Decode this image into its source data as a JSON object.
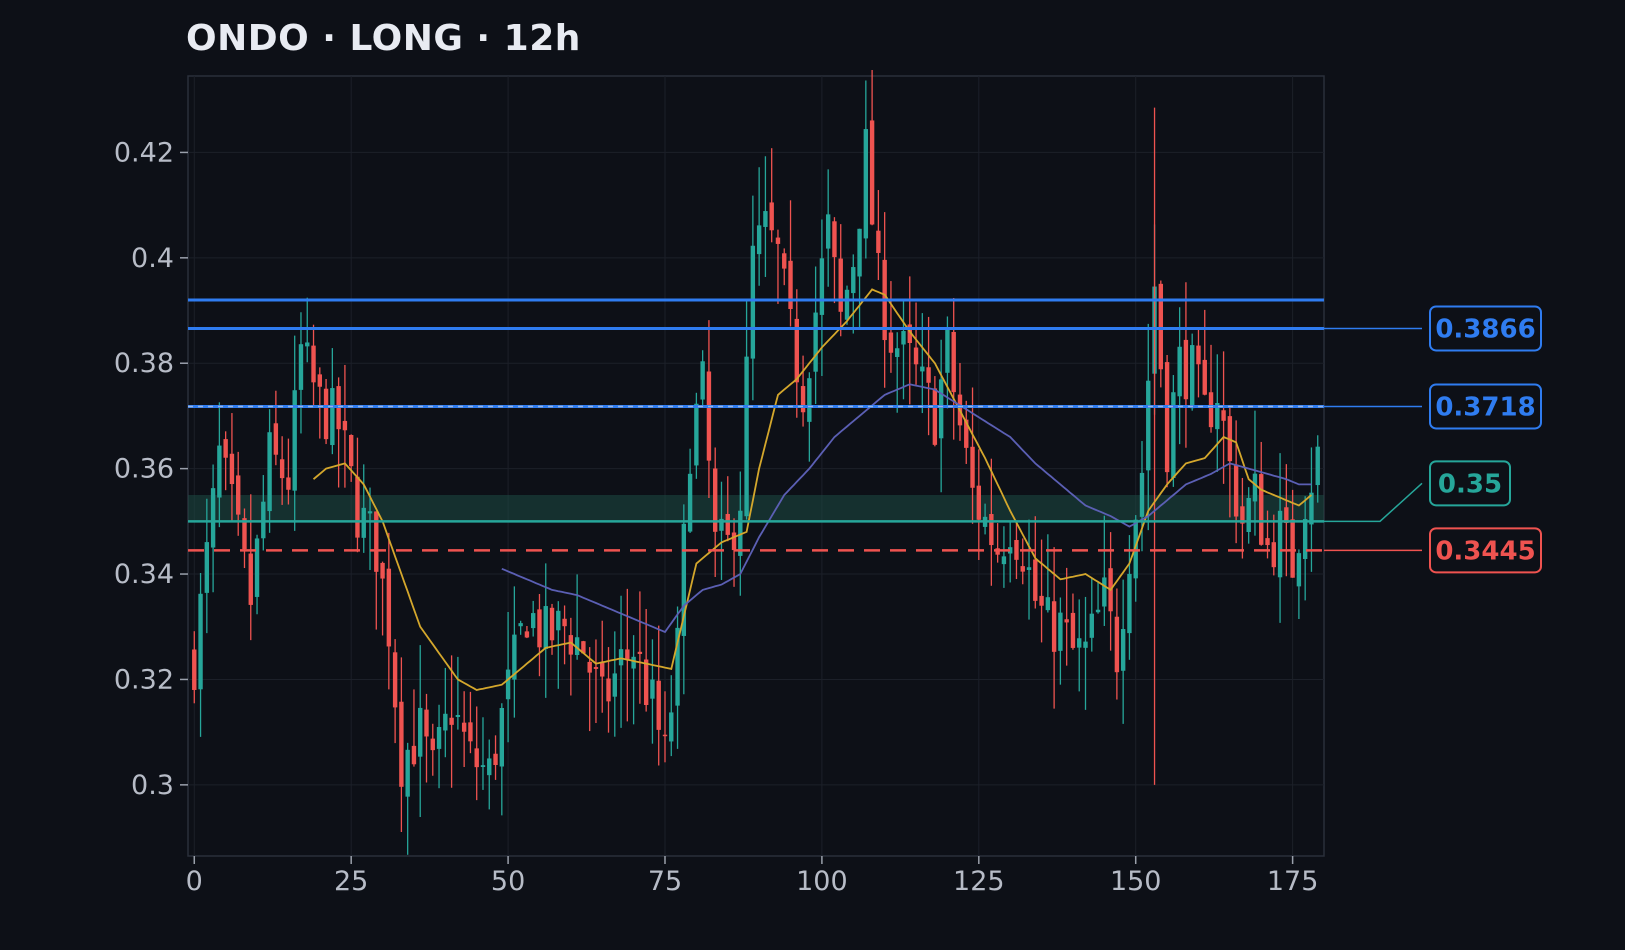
{
  "title": "ONDO · LONG · 12h",
  "colors": {
    "background": "#0d1017",
    "up": "#26a69a",
    "down": "#ef5350",
    "target": "#2f7cf0",
    "entry": "#26a69a",
    "stop": "#ef5350",
    "ema_fast": "#d4a72c",
    "ema_slow": "#5b5fb4",
    "grid": "#1c2029",
    "axis_text": "#b7bcc7"
  },
  "chart_data": {
    "type": "candlestick",
    "title": "ONDO · LONG · 12h",
    "xlim": [
      -1,
      180
    ],
    "ylim": [
      0.2865,
      0.4345
    ],
    "x_ticks": [
      0,
      25,
      50,
      75,
      100,
      125,
      150,
      175
    ],
    "x_tick_labels": [
      "0",
      "25",
      "50",
      "75",
      "100",
      "125",
      "150",
      "175"
    ],
    "y_ticks": [
      0.3,
      0.32,
      0.34,
      0.36,
      0.38,
      0.4,
      0.42
    ],
    "y_tick_labels": [
      "0.3",
      "0.32",
      "0.34",
      "0.36",
      "0.38",
      "0.4",
      "0.42"
    ],
    "grid": true,
    "candle_anchors": [
      [
        0,
        0.324
      ],
      [
        4,
        0.362
      ],
      [
        6,
        0.352
      ],
      [
        9,
        0.335
      ],
      [
        12,
        0.362
      ],
      [
        15,
        0.358
      ],
      [
        17,
        0.382
      ],
      [
        20,
        0.372
      ],
      [
        23,
        0.368
      ],
      [
        26,
        0.352
      ],
      [
        29,
        0.345
      ],
      [
        31,
        0.33
      ],
      [
        33,
        0.305
      ],
      [
        36,
        0.31
      ],
      [
        38,
        0.302
      ],
      [
        41,
        0.315
      ],
      [
        44,
        0.305
      ],
      [
        47,
        0.302
      ],
      [
        50,
        0.318
      ],
      [
        53,
        0.333
      ],
      [
        56,
        0.328
      ],
      [
        59,
        0.33
      ],
      [
        62,
        0.326
      ],
      [
        65,
        0.315
      ],
      [
        68,
        0.323
      ],
      [
        70,
        0.326
      ],
      [
        73,
        0.315
      ],
      [
        75,
        0.305
      ],
      [
        77,
        0.325
      ],
      [
        79,
        0.365
      ],
      [
        81,
        0.375
      ],
      [
        83,
        0.345
      ],
      [
        85,
        0.345
      ],
      [
        87,
        0.355
      ],
      [
        89,
        0.4
      ],
      [
        91,
        0.405
      ],
      [
        93,
        0.4
      ],
      [
        95,
        0.385
      ],
      [
        97,
        0.375
      ],
      [
        99,
        0.39
      ],
      [
        101,
        0.405
      ],
      [
        103,
        0.388
      ],
      [
        105,
        0.4
      ],
      [
        107,
        0.42
      ],
      [
        109,
        0.395
      ],
      [
        111,
        0.385
      ],
      [
        114,
        0.38
      ],
      [
        116,
        0.375
      ],
      [
        118,
        0.37
      ],
      [
        120,
        0.382
      ],
      [
        122,
        0.368
      ],
      [
        124,
        0.355
      ],
      [
        126,
        0.35
      ],
      [
        128,
        0.345
      ],
      [
        130,
        0.35
      ],
      [
        132,
        0.345
      ],
      [
        134,
        0.335
      ],
      [
        136,
        0.33
      ],
      [
        138,
        0.33
      ],
      [
        140,
        0.325
      ],
      [
        142,
        0.325
      ],
      [
        145,
        0.335
      ],
      [
        147,
        0.325
      ],
      [
        149,
        0.345
      ],
      [
        151,
        0.36
      ],
      [
        153,
        0.395
      ],
      [
        155,
        0.365
      ],
      [
        157,
        0.38
      ],
      [
        159,
        0.378
      ],
      [
        161,
        0.37
      ],
      [
        163,
        0.375
      ],
      [
        165,
        0.36
      ],
      [
        167,
        0.35
      ],
      [
        169,
        0.355
      ],
      [
        171,
        0.345
      ],
      [
        173,
        0.348
      ],
      [
        175,
        0.342
      ],
      [
        177,
        0.355
      ],
      [
        179,
        0.362
      ]
    ],
    "ema_fast_anchors": [
      [
        19,
        0.358
      ],
      [
        21,
        0.36
      ],
      [
        24,
        0.361
      ],
      [
        27,
        0.357
      ],
      [
        30,
        0.35
      ],
      [
        33,
        0.34
      ],
      [
        36,
        0.33
      ],
      [
        39,
        0.325
      ],
      [
        42,
        0.32
      ],
      [
        45,
        0.318
      ],
      [
        49,
        0.319
      ],
      [
        52,
        0.322
      ],
      [
        56,
        0.326
      ],
      [
        60,
        0.327
      ],
      [
        64,
        0.323
      ],
      [
        68,
        0.324
      ],
      [
        72,
        0.323
      ],
      [
        76,
        0.322
      ],
      [
        80,
        0.342
      ],
      [
        84,
        0.346
      ],
      [
        88,
        0.348
      ],
      [
        90,
        0.36
      ],
      [
        93,
        0.374
      ],
      [
        96,
        0.377
      ],
      [
        100,
        0.383
      ],
      [
        104,
        0.388
      ],
      [
        108,
        0.394
      ],
      [
        110,
        0.393
      ],
      [
        114,
        0.386
      ],
      [
        118,
        0.38
      ],
      [
        122,
        0.371
      ],
      [
        126,
        0.362
      ],
      [
        130,
        0.352
      ],
      [
        134,
        0.343
      ],
      [
        138,
        0.339
      ],
      [
        142,
        0.34
      ],
      [
        146,
        0.337
      ],
      [
        149,
        0.342
      ],
      [
        152,
        0.352
      ],
      [
        155,
        0.357
      ],
      [
        158,
        0.361
      ],
      [
        161,
        0.362
      ],
      [
        164,
        0.366
      ],
      [
        166,
        0.365
      ],
      [
        168,
        0.358
      ],
      [
        170,
        0.356
      ],
      [
        172,
        0.355
      ],
      [
        174,
        0.354
      ],
      [
        176,
        0.353
      ],
      [
        178,
        0.355
      ]
    ],
    "ema_slow_anchors": [
      [
        49,
        0.341
      ],
      [
        53,
        0.339
      ],
      [
        57,
        0.337
      ],
      [
        61,
        0.336
      ],
      [
        65,
        0.334
      ],
      [
        69,
        0.332
      ],
      [
        73,
        0.33
      ],
      [
        75,
        0.329
      ],
      [
        78,
        0.334
      ],
      [
        81,
        0.337
      ],
      [
        84,
        0.338
      ],
      [
        87,
        0.34
      ],
      [
        90,
        0.347
      ],
      [
        94,
        0.355
      ],
      [
        98,
        0.36
      ],
      [
        102,
        0.366
      ],
      [
        106,
        0.37
      ],
      [
        110,
        0.374
      ],
      [
        114,
        0.376
      ],
      [
        118,
        0.375
      ],
      [
        122,
        0.372
      ],
      [
        126,
        0.369
      ],
      [
        130,
        0.366
      ],
      [
        134,
        0.361
      ],
      [
        138,
        0.357
      ],
      [
        142,
        0.353
      ],
      [
        146,
        0.351
      ],
      [
        149,
        0.349
      ],
      [
        152,
        0.351
      ],
      [
        155,
        0.354
      ],
      [
        158,
        0.357
      ],
      [
        162,
        0.359
      ],
      [
        165,
        0.361
      ],
      [
        168,
        0.36
      ],
      [
        171,
        0.359
      ],
      [
        174,
        0.358
      ],
      [
        176,
        0.357
      ],
      [
        178,
        0.357
      ]
    ],
    "annotations": {
      "targets": [
        0.392,
        0.3866,
        0.3718
      ],
      "entry": 0.35,
      "entry_zone": [
        0.35,
        0.355
      ],
      "stop": 0.3445,
      "spike": {
        "x": 153,
        "high": 0.4285,
        "low": 0.3
      }
    },
    "badges": [
      {
        "label": "0.3866",
        "value": 0.3866,
        "role": "target"
      },
      {
        "label": "0.3718",
        "value": 0.3718,
        "role": "target"
      },
      {
        "label": "0.35",
        "value": 0.35,
        "role": "entry"
      },
      {
        "label": "0.3445",
        "value": 0.3445,
        "role": "stop"
      }
    ]
  }
}
